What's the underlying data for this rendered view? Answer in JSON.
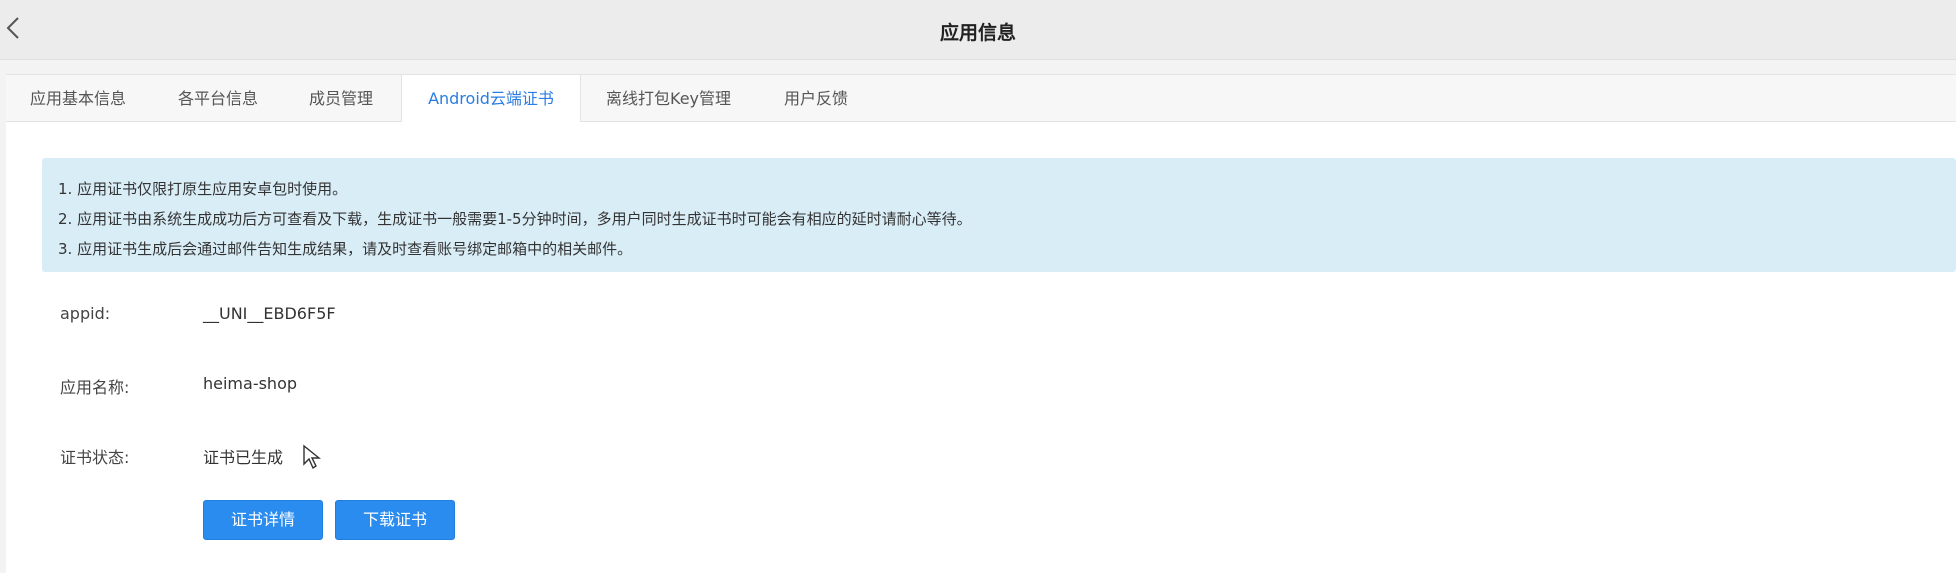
{
  "header": {
    "title": "应用信息"
  },
  "tabs": [
    {
      "label": "应用基本信息",
      "active": false
    },
    {
      "label": "各平台信息",
      "active": false
    },
    {
      "label": "成员管理",
      "active": false
    },
    {
      "label": "Android云端证书",
      "active": true
    },
    {
      "label": "离线打包Key管理",
      "active": false
    },
    {
      "label": "用户反馈",
      "active": false
    }
  ],
  "notice": {
    "lines": [
      "1. 应用证书仅限打原生应用安卓包时使用。",
      "2. 应用证书由系统生成成功后方可查看及下载，生成证书一般需要1-5分钟时间，多用户同时生成证书时可能会有相应的延时请耐心等待。",
      "3. 应用证书生成后会通过邮件告知生成结果，请及时查看账号绑定邮箱中的相关邮件。"
    ]
  },
  "fields": {
    "appid": {
      "label": "appid:",
      "value": "__UNI__EBD6F5F"
    },
    "app_name": {
      "label": "应用名称:",
      "value": "heima-shop"
    },
    "cert_status": {
      "label": "证书状态:",
      "value": "证书已生成"
    }
  },
  "buttons": {
    "details": "证书详情",
    "download": "下载证书"
  },
  "colors": {
    "accent": "#2b8cf0",
    "active_tab_text": "#2a7de1",
    "notice_bg": "#d9edf7"
  }
}
